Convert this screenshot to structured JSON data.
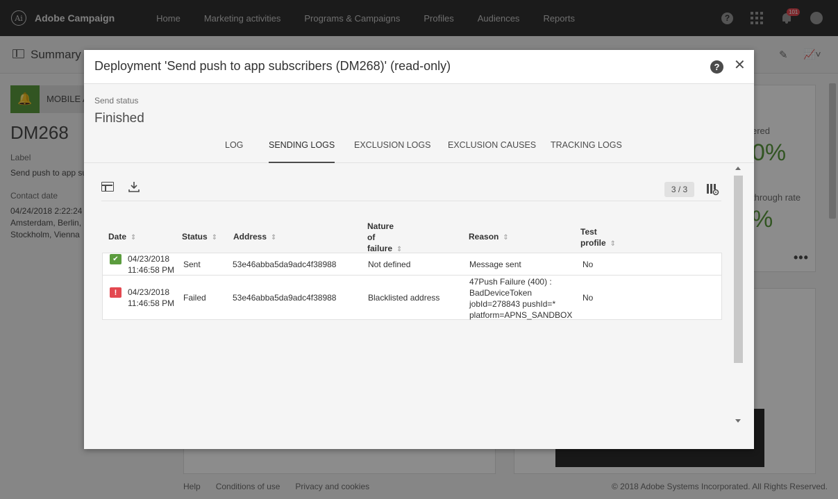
{
  "app": {
    "name": "Adobe Campaign",
    "logo_glyph": "Ai",
    "nav": [
      "Home",
      "Marketing activities",
      "Programs & Campaigns",
      "Profiles",
      "Audiences",
      "Reports"
    ],
    "notification_count": "101",
    "help_glyph": "?"
  },
  "background": {
    "summary_title": "Summary",
    "channel_label": "MOBILE A",
    "delivery_code": "DM268",
    "label_caption": "Label",
    "label_value": "Send push to app su",
    "contact_caption": "Contact date",
    "contact_value_1": "04/24/2018 2:22:24 P",
    "contact_value_2": "Amsterdam, Berlin, B",
    "contact_value_3": "Stockholm, Vienna",
    "stat1_label": "ered",
    "stat1_value": "0%",
    "stat2_label": "through rate",
    "stat2_value": "%",
    "more_glyph": "•••",
    "footer_links": [
      "Help",
      "Conditions of use",
      "Privacy and cookies"
    ],
    "copyright": "© 2018 Adobe Systems Incorporated. All Rights Reserved."
  },
  "dialog": {
    "title": "Deployment 'Send push to app subscribers (DM268)' (read-only)",
    "help_glyph": "?",
    "close_glyph": "✕",
    "send_status_label": "Send status",
    "send_status_value": "Finished",
    "tabs": [
      "LOG",
      "SENDING LOGS",
      "EXCLUSION LOGS",
      "EXCLUSION CAUSES",
      "TRACKING LOGS"
    ],
    "active_tab": "SENDING LOGS",
    "record_count": "3 / 3",
    "columns": {
      "date": "Date",
      "status": "Status",
      "address": "Address",
      "nature_1": "Nature",
      "nature_2": "of",
      "nature_3": "failure",
      "reason": "Reason",
      "test_1": "Test",
      "test_2": "profile"
    },
    "rows": [
      {
        "icon": "success",
        "date": "04/23/2018",
        "time": "11:46:58 PM",
        "status": "Sent",
        "address": "53e46abba5da9adc4f38988",
        "nature": "Not defined",
        "reason_1": "Message sent",
        "test_profile": "No"
      },
      {
        "icon": "error",
        "date": "04/23/2018",
        "time": "11:46:58 PM",
        "status": "Failed",
        "address": "53e46abba5da9adc4f38988",
        "nature": "Blacklisted address",
        "reason_1": "47Push Failure (400) :",
        "reason_2": "BadDeviceToken",
        "reason_3": "jobId=278843 pushId=*",
        "reason_4": "platform=APNS_SANDBOX",
        "test_profile": "No"
      }
    ]
  },
  "colors": {
    "topbar": "#323232",
    "success": "#5b9c3e",
    "error": "#e34850"
  }
}
